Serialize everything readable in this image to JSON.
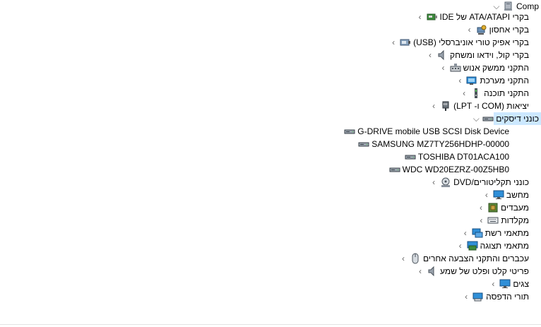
{
  "tree": {
    "root": {
      "label": "Comp",
      "icon": "computer-icon",
      "expanded": true
    },
    "categories": [
      {
        "label": "בקרי ATA/ATAPI של IDE",
        "icon": "ide-controller-icon"
      },
      {
        "label": "בקרי אחסון",
        "icon": "storage-controller-icon"
      },
      {
        "label": "בקרי אפיק טורי אוניברסלי (USB)",
        "icon": "usb-controller-icon"
      },
      {
        "label": "בקרי קול, וידאו ומשחק",
        "icon": "speaker-icon"
      },
      {
        "label": "התקני ממשק אנוש",
        "icon": "hid-icon"
      },
      {
        "label": "התקני מערכת",
        "icon": "system-device-icon"
      },
      {
        "label": "התקני תוכנה",
        "icon": "software-device-icon"
      },
      {
        "label": "יציאות (COM ו- LPT)",
        "icon": "port-icon"
      },
      {
        "label": "כונני דיסקים",
        "icon": "disk-drive-icon",
        "expanded": true,
        "selected": true
      },
      {
        "label": "כונני תקליטורים/DVD",
        "icon": "dvd-drive-icon"
      },
      {
        "label": "מחשב",
        "icon": "monitor-icon"
      },
      {
        "label": "מעבדים",
        "icon": "processor-icon"
      },
      {
        "label": "מקלדות",
        "icon": "keyboard-icon"
      },
      {
        "label": "מתאמי רשת",
        "icon": "network-adapter-icon"
      },
      {
        "label": "מתאמי תצוגה",
        "icon": "display-adapter-icon"
      },
      {
        "label": "עכברים והתקני הצבעה אחרים",
        "icon": "mouse-icon"
      },
      {
        "label": "פריטי קלט ופלט של שמע",
        "icon": "audio-io-icon"
      },
      {
        "label": "צגים",
        "icon": "monitor-icon"
      },
      {
        "label": "תורי הדפסה",
        "icon": "print-queue-icon"
      }
    ],
    "disk_drives": [
      "G-DRIVE mobile USB SCSI Disk Device",
      "SAMSUNG MZ7TY256HDHP-00000",
      "TOSHIBA DT01ACA100",
      "WDC WD20EZRZ-00Z5HB0"
    ]
  },
  "colors": {
    "selection": "#cce8ff",
    "chevron": "#666666"
  }
}
